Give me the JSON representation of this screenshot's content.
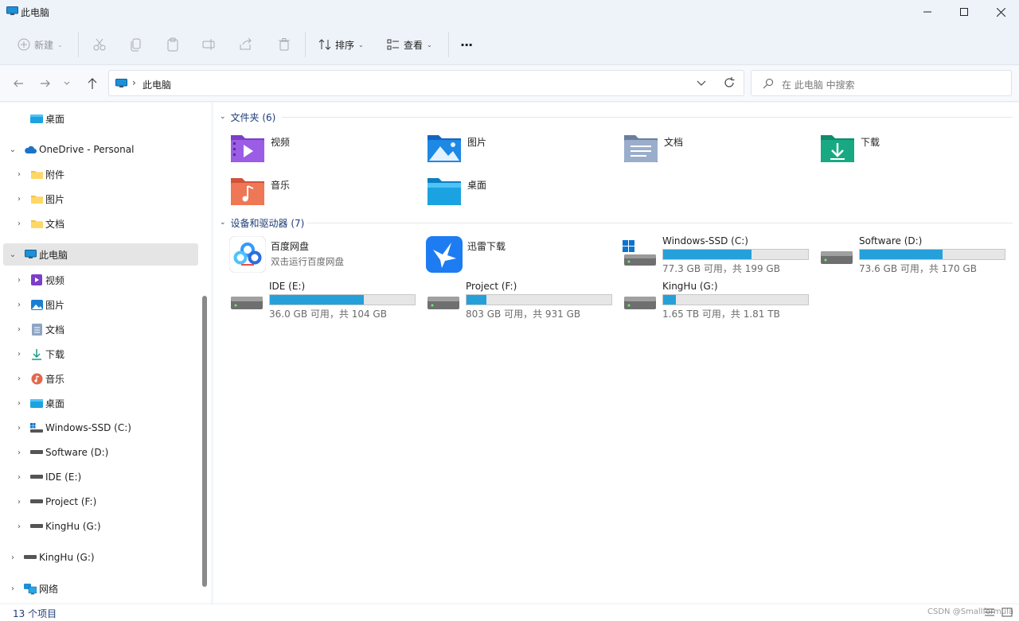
{
  "window": {
    "title": "此电脑"
  },
  "toolbar": {
    "new_label": "新建",
    "sort_label": "排序",
    "view_label": "查看",
    "more_label": "···"
  },
  "address": {
    "path": "此电脑",
    "separator": "›"
  },
  "search": {
    "placeholder": "在 此电脑 中搜索"
  },
  "sidebar": {
    "items": [
      {
        "label": "桌面",
        "icon": "desktop-icon"
      },
      {
        "label": "OneDrive - Personal",
        "icon": "cloud-icon"
      },
      {
        "label": "附件",
        "icon": "folder-icon"
      },
      {
        "label": "图片",
        "icon": "folder-icon"
      },
      {
        "label": "文档",
        "icon": "folder-icon"
      },
      {
        "label": "此电脑",
        "icon": "computer-icon"
      },
      {
        "label": "视频",
        "icon": "video-icon"
      },
      {
        "label": "图片",
        "icon": "pictures-icon"
      },
      {
        "label": "文档",
        "icon": "documents-icon"
      },
      {
        "label": "下载",
        "icon": "download-icon"
      },
      {
        "label": "音乐",
        "icon": "music-icon"
      },
      {
        "label": "桌面",
        "icon": "desktop-icon"
      },
      {
        "label": "Windows-SSD (C:)",
        "icon": "system-drive-icon"
      },
      {
        "label": "Software (D:)",
        "icon": "drive-icon"
      },
      {
        "label": "IDE (E:)",
        "icon": "drive-icon"
      },
      {
        "label": "Project (F:)",
        "icon": "drive-icon"
      },
      {
        "label": "KingHu (G:)",
        "icon": "drive-icon"
      },
      {
        "label": "KingHu (G:)",
        "icon": "drive-icon"
      },
      {
        "label": "网络",
        "icon": "network-icon"
      }
    ]
  },
  "content": {
    "folders_header": "文件夹 (6)",
    "devices_header": "设备和驱动器 (7)",
    "folders": [
      {
        "label": "视频",
        "icon": "video-folder-icon"
      },
      {
        "label": "图片",
        "icon": "pictures-folder-icon"
      },
      {
        "label": "文档",
        "icon": "documents-folder-icon"
      },
      {
        "label": "下载",
        "icon": "downloads-folder-icon"
      },
      {
        "label": "音乐",
        "icon": "music-folder-icon"
      },
      {
        "label": "桌面",
        "icon": "desktop-folder-icon"
      }
    ],
    "apps": [
      {
        "label": "百度网盘",
        "subtitle": "双击运行百度网盘",
        "icon": "baidu-netdisk-icon"
      },
      {
        "label": "迅雷下载",
        "subtitle": "",
        "icon": "xunlei-icon"
      }
    ],
    "drives": [
      {
        "name": "Windows-SSD (C:)",
        "free": "77.3 GB 可用，共 199 GB",
        "used_fraction": 0.61,
        "icon": "system-drive-icon"
      },
      {
        "name": "Software (D:)",
        "free": "73.6 GB 可用，共 170 GB",
        "used_fraction": 0.57,
        "icon": "drive-icon"
      },
      {
        "name": "IDE (E:)",
        "free": "36.0 GB 可用，共 104 GB",
        "used_fraction": 0.65,
        "icon": "drive-icon"
      },
      {
        "name": "Project (F:)",
        "free": "803 GB 可用，共 931 GB",
        "used_fraction": 0.14,
        "icon": "drive-icon"
      },
      {
        "name": "KingHu (G:)",
        "free": "1.65 TB 可用，共 1.81 TB",
        "used_fraction": 0.09,
        "icon": "drive-icon"
      }
    ]
  },
  "status": {
    "item_count": "13 个项目",
    "watermark": "CSDN @Smallformula"
  },
  "colors": {
    "accent": "#26a0da",
    "selected": "#e5e5e5",
    "header_text": "#1f3c78"
  }
}
